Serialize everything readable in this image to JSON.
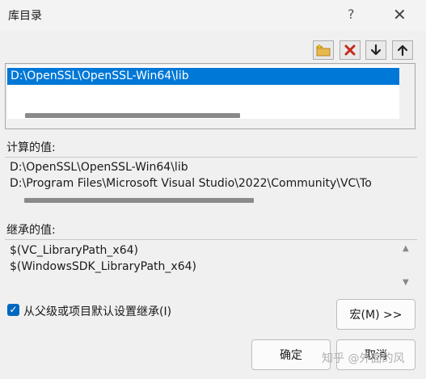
{
  "window": {
    "title": "库目录",
    "help": "?",
    "close": "✕"
  },
  "toolbar": {
    "buttons": [
      {
        "name": "new-line",
        "icon": "folder-star-icon"
      },
      {
        "name": "delete",
        "icon": "red-x-icon"
      },
      {
        "name": "move-down",
        "icon": "arrow-down-icon"
      },
      {
        "name": "move-up",
        "icon": "arrow-up-icon"
      }
    ]
  },
  "list": {
    "items": [
      "D:\\OpenSSL\\OpenSSL-Win64\\lib"
    ]
  },
  "evaluated": {
    "label": "计算的值:",
    "lines": [
      "D:\\OpenSSL\\OpenSSL-Win64\\lib",
      "D:\\Program Files\\Microsoft Visual Studio\\2022\\Community\\VC\\To"
    ]
  },
  "inherited": {
    "label": "继承的值:",
    "lines": [
      "$(VC_LibraryPath_x64)",
      "$(WindowsSDK_LibraryPath_x64)"
    ],
    "scroll_up": "▲",
    "scroll_down": "▼"
  },
  "inherit_checkbox": {
    "label": "从父级或项目默认设置继承(I)",
    "checked": true
  },
  "buttons": {
    "macro": "宏(M) >>",
    "ok": "确定",
    "cancel": "取消"
  },
  "watermark": "知乎 @外面的风",
  "colors": {
    "selection": "#0078d7",
    "checkbox": "#0067c0",
    "delete": "#c42b1c"
  }
}
